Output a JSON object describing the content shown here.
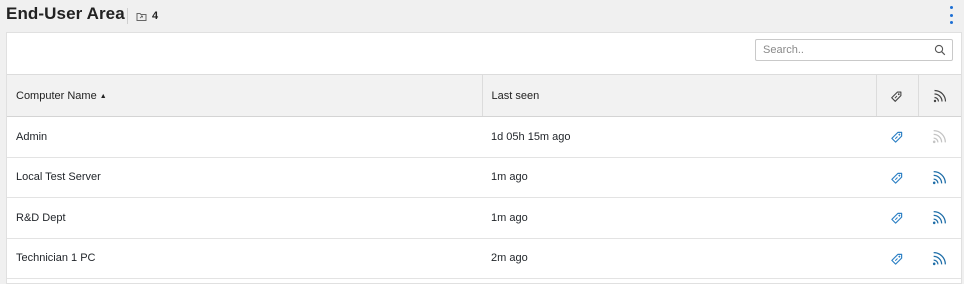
{
  "header": {
    "title": "End-User Area",
    "count": "4",
    "count_icon": "folder-share-icon",
    "menu_icon": "more-vertical-icon"
  },
  "search": {
    "placeholder": "Search.."
  },
  "table": {
    "columns": [
      {
        "label": "Computer Name",
        "sorted": "ascending"
      },
      {
        "label": "Last seen"
      },
      {
        "label": "",
        "icon": "license-tag-icon"
      },
      {
        "label": "",
        "icon": "signal-icon"
      }
    ],
    "rows": [
      {
        "computer_name": "Admin",
        "last_seen": "1d 05h 15m ago",
        "licensed": true,
        "online": false
      },
      {
        "computer_name": "Local Test Server",
        "last_seen": "1m ago",
        "licensed": true,
        "online": true
      },
      {
        "computer_name": "R&D Dept",
        "last_seen": "1m ago",
        "licensed": true,
        "online": true
      },
      {
        "computer_name": "Technician 1 PC",
        "last_seen": "2m ago",
        "licensed": true,
        "online": true
      }
    ]
  },
  "colors": {
    "accent": "#1e6fd4",
    "tag_icon": "#2b7fc4",
    "signal_online": "#1f6ea8",
    "signal_offline": "#c4c4c4",
    "header_bg": "#f2f2f2",
    "page_bg": "#f0f0f0"
  }
}
